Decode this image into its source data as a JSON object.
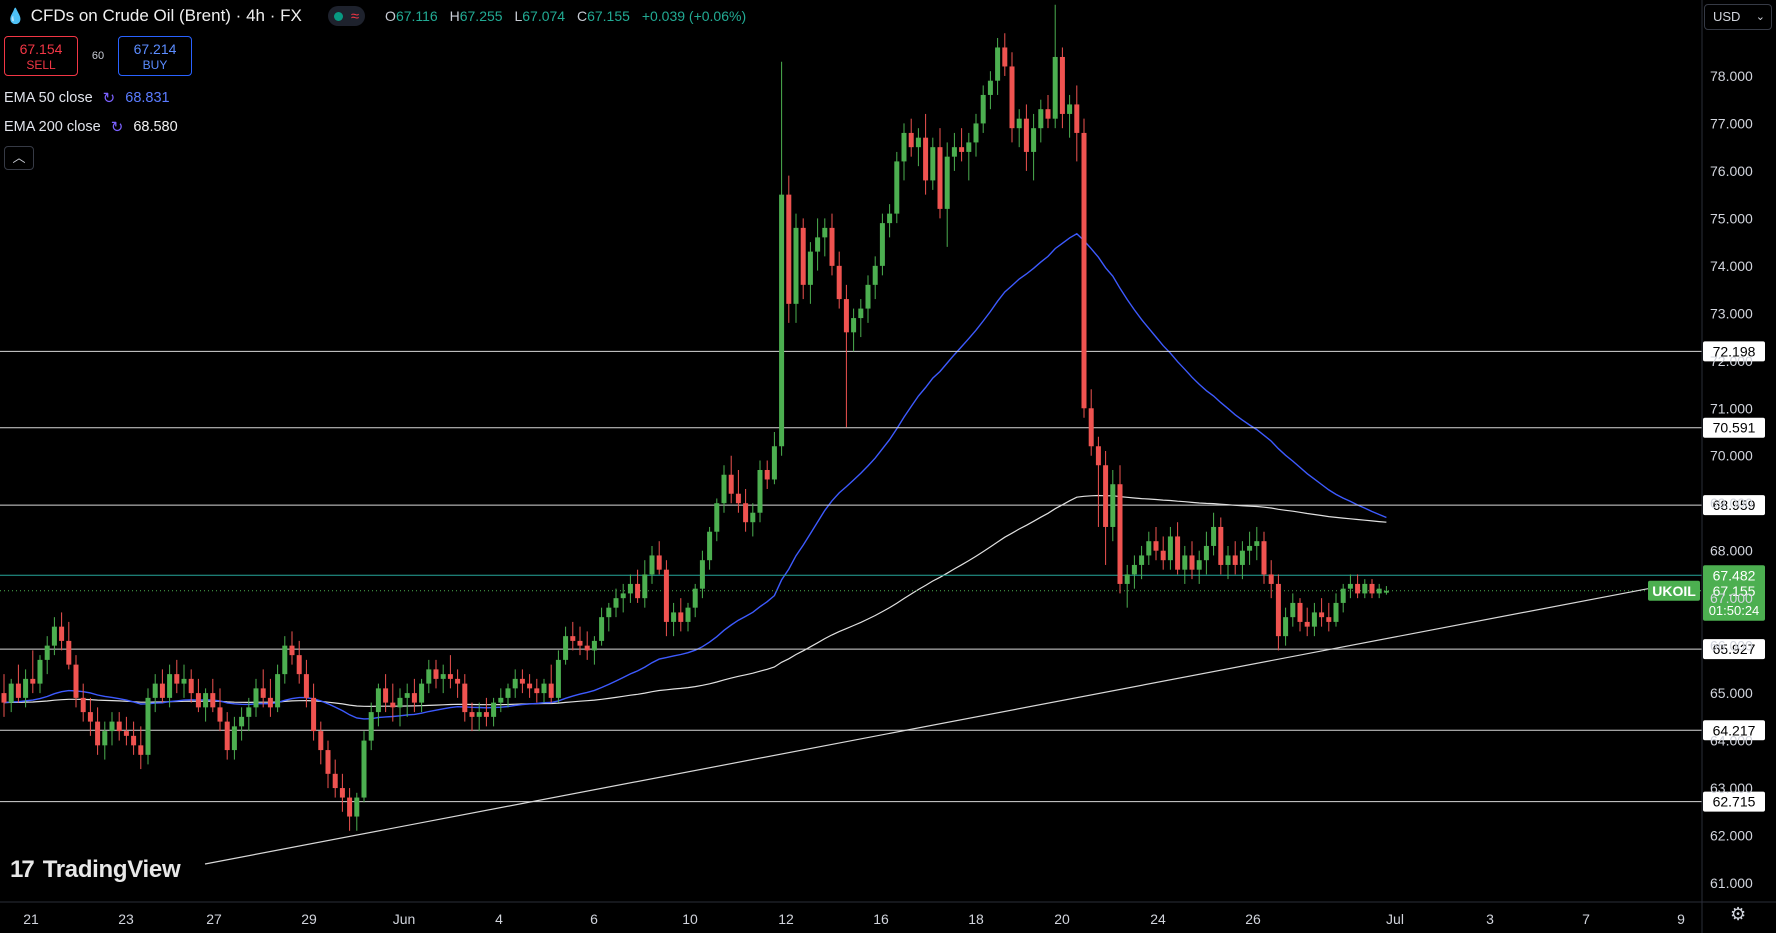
{
  "header": {
    "title": "CFDs on Crude Oil (Brent) · 4h · FX",
    "ohlc": [
      {
        "label": "O",
        "value": "67.116"
      },
      {
        "label": "H",
        "value": "67.255"
      },
      {
        "label": "L",
        "value": "67.074"
      },
      {
        "label": "C",
        "value": "67.155"
      }
    ],
    "change": "+0.039 (+0.06%)"
  },
  "trade": {
    "sell_price": "67.154",
    "sell_label": "SELL",
    "spread": "60",
    "buy_price": "67.214",
    "buy_label": "BUY"
  },
  "indicators": [
    {
      "label": "EMA 50 close",
      "value": "68.831",
      "color": "#3d5afe"
    },
    {
      "label": "EMA 200 close",
      "value": "68.580",
      "color": "#e0e0e0"
    }
  ],
  "currency": "USD",
  "logo_text": "TradingView",
  "colors": {
    "up": "#26a69a",
    "up_bright": "#4caf50",
    "down": "#ef5350",
    "bg": "#000000"
  },
  "chart_data": {
    "type": "candlestick",
    "symbol": "UKOIL",
    "ylim": [
      60.6,
      79.6
    ],
    "y_ticks": [
      "61.000",
      "62.000",
      "63.000",
      "64.000",
      "65.000",
      "66.000",
      "67.000",
      "68.000",
      "69.000",
      "70.000",
      "71.000",
      "72.000",
      "73.000",
      "74.000",
      "75.000",
      "76.000",
      "77.000",
      "78.000"
    ],
    "x_ticks": [
      "21",
      "23",
      "27",
      "29",
      "Jun",
      "4",
      "6",
      "10",
      "12",
      "16",
      "18",
      "20",
      "24",
      "26",
      "Jul",
      "3",
      "7",
      "9"
    ],
    "horizontal_levels": [
      "72.198",
      "70.591",
      "68.959",
      "67.482",
      "65.927",
      "64.217",
      "62.715"
    ],
    "last_price": "67.155",
    "countdown": "01:50:24",
    "candles": [
      [
        65.0,
        65.4,
        64.5,
        64.8
      ],
      [
        64.8,
        65.3,
        64.6,
        65.2
      ],
      [
        65.2,
        65.6,
        64.8,
        64.9
      ],
      [
        64.9,
        65.5,
        64.7,
        65.3
      ],
      [
        65.3,
        65.9,
        65.0,
        65.2
      ],
      [
        65.2,
        65.8,
        65.0,
        65.7
      ],
      [
        65.7,
        66.2,
        65.4,
        66.0
      ],
      [
        66.0,
        66.6,
        65.8,
        66.4
      ],
      [
        66.4,
        66.7,
        65.9,
        66.1
      ],
      [
        66.1,
        66.5,
        65.5,
        65.6
      ],
      [
        65.6,
        65.8,
        64.7,
        64.9
      ],
      [
        64.9,
        65.2,
        64.4,
        64.6
      ],
      [
        64.6,
        64.9,
        64.1,
        64.4
      ],
      [
        64.4,
        64.7,
        63.7,
        63.9
      ],
      [
        63.9,
        64.4,
        63.6,
        64.2
      ],
      [
        64.2,
        64.6,
        63.9,
        64.4
      ],
      [
        64.4,
        64.6,
        64.0,
        64.2
      ],
      [
        64.2,
        64.5,
        63.9,
        64.1
      ],
      [
        64.1,
        64.4,
        63.7,
        63.9
      ],
      [
        63.9,
        64.3,
        63.4,
        63.7
      ],
      [
        63.7,
        65.1,
        63.5,
        64.9
      ],
      [
        64.9,
        65.4,
        64.6,
        65.2
      ],
      [
        65.2,
        65.5,
        64.8,
        64.9
      ],
      [
        64.9,
        65.6,
        64.7,
        65.4
      ],
      [
        65.4,
        65.7,
        65.0,
        65.2
      ],
      [
        65.2,
        65.6,
        64.9,
        65.3
      ],
      [
        65.3,
        65.5,
        64.8,
        65.0
      ],
      [
        65.0,
        65.3,
        64.6,
        64.7
      ],
      [
        64.7,
        65.1,
        64.4,
        65.0
      ],
      [
        65.0,
        65.3,
        64.6,
        64.7
      ],
      [
        64.7,
        65.1,
        64.2,
        64.4
      ],
      [
        64.4,
        64.6,
        63.6,
        63.8
      ],
      [
        63.8,
        64.5,
        63.6,
        64.3
      ],
      [
        64.3,
        64.7,
        64.0,
        64.5
      ],
      [
        64.5,
        64.9,
        64.2,
        64.7
      ],
      [
        64.7,
        65.3,
        64.5,
        65.1
      ],
      [
        65.1,
        65.5,
        64.7,
        64.9
      ],
      [
        64.9,
        65.3,
        64.5,
        64.7
      ],
      [
        64.7,
        65.6,
        64.6,
        65.4
      ],
      [
        65.4,
        66.2,
        65.2,
        66.0
      ],
      [
        66.0,
        66.3,
        65.6,
        65.8
      ],
      [
        65.8,
        66.1,
        65.2,
        65.4
      ],
      [
        65.4,
        65.7,
        64.7,
        64.9
      ],
      [
        64.9,
        65.2,
        64.0,
        64.2
      ],
      [
        64.2,
        64.4,
        63.5,
        63.8
      ],
      [
        63.8,
        64.0,
        63.0,
        63.3
      ],
      [
        63.3,
        63.6,
        62.8,
        63.0
      ],
      [
        63.0,
        63.3,
        62.5,
        62.8
      ],
      [
        62.8,
        63.0,
        62.1,
        62.4
      ],
      [
        62.4,
        62.9,
        62.1,
        62.8
      ],
      [
        62.8,
        64.2,
        62.7,
        64.0
      ],
      [
        64.0,
        64.8,
        63.8,
        64.6
      ],
      [
        64.6,
        65.2,
        64.3,
        65.1
      ],
      [
        65.1,
        65.4,
        64.6,
        64.8
      ],
      [
        64.8,
        65.2,
        64.4,
        64.7
      ],
      [
        64.7,
        65.1,
        64.3,
        64.9
      ],
      [
        64.9,
        65.2,
        64.5,
        65.0
      ],
      [
        65.0,
        65.3,
        64.6,
        64.8
      ],
      [
        64.8,
        65.3,
        64.6,
        65.2
      ],
      [
        65.2,
        65.7,
        65.0,
        65.5
      ],
      [
        65.5,
        65.7,
        65.1,
        65.3
      ],
      [
        65.3,
        65.6,
        65.0,
        65.4
      ],
      [
        65.4,
        65.8,
        65.1,
        65.3
      ],
      [
        65.3,
        65.5,
        64.9,
        65.2
      ],
      [
        65.2,
        65.4,
        64.4,
        64.6
      ],
      [
        64.6,
        64.8,
        64.2,
        64.5
      ],
      [
        64.5,
        64.8,
        64.2,
        64.6
      ],
      [
        64.6,
        64.9,
        64.3,
        64.5
      ],
      [
        64.5,
        64.9,
        64.3,
        64.8
      ],
      [
        64.8,
        65.1,
        64.6,
        64.9
      ],
      [
        64.9,
        65.2,
        64.7,
        65.1
      ],
      [
        65.1,
        65.5,
        64.9,
        65.3
      ],
      [
        65.3,
        65.5,
        65.0,
        65.2
      ],
      [
        65.2,
        65.4,
        64.9,
        65.1
      ],
      [
        65.1,
        65.3,
        64.8,
        65.0
      ],
      [
        65.0,
        65.3,
        64.8,
        65.2
      ],
      [
        65.2,
        65.6,
        64.8,
        64.9
      ],
      [
        64.9,
        65.9,
        64.8,
        65.7
      ],
      [
        65.7,
        66.4,
        65.6,
        66.2
      ],
      [
        66.2,
        66.5,
        65.9,
        66.1
      ],
      [
        66.1,
        66.4,
        65.8,
        66.0
      ],
      [
        66.0,
        66.3,
        65.7,
        65.9
      ],
      [
        65.9,
        66.2,
        65.6,
        66.1
      ],
      [
        66.1,
        66.8,
        66.0,
        66.6
      ],
      [
        66.6,
        66.9,
        66.3,
        66.8
      ],
      [
        66.8,
        67.2,
        66.6,
        67.0
      ],
      [
        67.0,
        67.3,
        66.7,
        67.1
      ],
      [
        67.1,
        67.5,
        66.9,
        67.3
      ],
      [
        67.3,
        67.6,
        66.9,
        67.0
      ],
      [
        67.0,
        67.8,
        66.8,
        67.5
      ],
      [
        67.5,
        68.1,
        67.3,
        67.9
      ],
      [
        67.9,
        68.2,
        67.5,
        67.6
      ],
      [
        67.6,
        67.8,
        66.2,
        66.5
      ],
      [
        66.5,
        66.9,
        66.2,
        66.7
      ],
      [
        66.7,
        67.0,
        66.3,
        66.5
      ],
      [
        66.5,
        66.9,
        66.3,
        66.8
      ],
      [
        66.8,
        67.3,
        66.6,
        67.2
      ],
      [
        67.2,
        68.0,
        67.0,
        67.8
      ],
      [
        67.8,
        68.5,
        67.6,
        68.4
      ],
      [
        68.4,
        69.1,
        68.2,
        69.0
      ],
      [
        69.0,
        69.8,
        68.8,
        69.6
      ],
      [
        69.6,
        70.0,
        69.0,
        69.2
      ],
      [
        69.2,
        69.7,
        68.8,
        69.0
      ],
      [
        69.0,
        69.3,
        68.4,
        68.6
      ],
      [
        68.6,
        69.0,
        68.3,
        68.8
      ],
      [
        68.8,
        69.9,
        68.6,
        69.7
      ],
      [
        69.7,
        69.9,
        69.3,
        69.5
      ],
      [
        69.5,
        70.5,
        69.4,
        70.2
      ],
      [
        70.2,
        78.3,
        70.0,
        75.5
      ],
      [
        75.5,
        75.9,
        72.8,
        73.2
      ],
      [
        73.2,
        75.1,
        72.8,
        74.8
      ],
      [
        74.8,
        75.0,
        73.3,
        73.6
      ],
      [
        73.6,
        74.5,
        73.2,
        74.3
      ],
      [
        74.3,
        75.0,
        73.9,
        74.6
      ],
      [
        74.6,
        75.0,
        74.2,
        74.8
      ],
      [
        74.8,
        75.1,
        73.8,
        74.0
      ],
      [
        74.0,
        74.3,
        73.1,
        73.3
      ],
      [
        73.3,
        73.6,
        70.6,
        72.6
      ],
      [
        72.6,
        73.1,
        72.2,
        72.9
      ],
      [
        72.9,
        73.3,
        72.5,
        73.1
      ],
      [
        73.1,
        73.8,
        72.8,
        73.6
      ],
      [
        73.6,
        74.2,
        73.3,
        74.0
      ],
      [
        74.0,
        75.1,
        73.8,
        74.9
      ],
      [
        74.9,
        75.3,
        74.6,
        75.1
      ],
      [
        75.1,
        76.4,
        74.9,
        76.2
      ],
      [
        76.2,
        77.0,
        75.8,
        76.8
      ],
      [
        76.8,
        77.1,
        76.3,
        76.5
      ],
      [
        76.5,
        76.9,
        76.1,
        76.7
      ],
      [
        76.7,
        77.2,
        75.5,
        75.8
      ],
      [
        75.8,
        76.7,
        75.6,
        76.5
      ],
      [
        76.5,
        76.9,
        75.0,
        75.2
      ],
      [
        75.2,
        76.6,
        74.4,
        76.3
      ],
      [
        76.3,
        76.8,
        76.0,
        76.5
      ],
      [
        76.5,
        76.9,
        76.2,
        76.4
      ],
      [
        76.4,
        76.8,
        75.8,
        76.6
      ],
      [
        76.6,
        77.2,
        76.3,
        77.0
      ],
      [
        77.0,
        77.8,
        76.8,
        77.6
      ],
      [
        77.6,
        78.1,
        77.3,
        77.9
      ],
      [
        77.9,
        78.8,
        77.6,
        78.6
      ],
      [
        78.6,
        78.9,
        78.0,
        78.2
      ],
      [
        78.2,
        78.5,
        76.6,
        76.9
      ],
      [
        76.9,
        77.3,
        76.5,
        77.1
      ],
      [
        77.1,
        77.4,
        76.0,
        76.4
      ],
      [
        76.4,
        77.2,
        75.8,
        76.9
      ],
      [
        76.9,
        77.5,
        76.6,
        77.3
      ],
      [
        77.3,
        77.6,
        76.9,
        77.1
      ],
      [
        77.1,
        79.5,
        76.9,
        78.4
      ],
      [
        78.4,
        78.6,
        76.9,
        77.2
      ],
      [
        77.2,
        77.6,
        76.7,
        77.4
      ],
      [
        77.4,
        77.8,
        76.2,
        76.8
      ],
      [
        76.8,
        77.1,
        70.8,
        71.0
      ],
      [
        71.0,
        71.4,
        70.0,
        70.2
      ],
      [
        70.2,
        70.4,
        68.5,
        69.8
      ],
      [
        69.8,
        70.1,
        67.7,
        68.5
      ],
      [
        68.5,
        69.7,
        68.2,
        69.4
      ],
      [
        69.4,
        69.8,
        67.1,
        67.3
      ],
      [
        67.3,
        67.7,
        66.8,
        67.5
      ],
      [
        67.5,
        67.9,
        67.2,
        67.7
      ],
      [
        67.7,
        68.1,
        67.4,
        67.9
      ],
      [
        67.9,
        68.4,
        67.7,
        68.2
      ],
      [
        68.2,
        68.5,
        67.8,
        68.0
      ],
      [
        68.0,
        68.3,
        67.6,
        67.8
      ],
      [
        67.8,
        68.5,
        67.6,
        68.3
      ],
      [
        68.3,
        68.6,
        67.5,
        67.6
      ],
      [
        67.6,
        68.1,
        67.3,
        67.9
      ],
      [
        67.9,
        68.2,
        67.4,
        67.6
      ],
      [
        67.6,
        68.0,
        67.3,
        67.8
      ],
      [
        67.8,
        68.4,
        67.5,
        68.1
      ],
      [
        68.1,
        68.8,
        67.9,
        68.5
      ],
      [
        68.5,
        68.7,
        67.5,
        67.7
      ],
      [
        67.7,
        68.1,
        67.4,
        67.9
      ],
      [
        67.9,
        68.2,
        67.5,
        67.7
      ],
      [
        67.7,
        68.2,
        67.4,
        68.0
      ],
      [
        68.0,
        68.4,
        67.7,
        68.1
      ],
      [
        68.1,
        68.5,
        67.8,
        68.2
      ],
      [
        68.2,
        68.4,
        67.3,
        67.5
      ],
      [
        67.5,
        67.8,
        67.0,
        67.3
      ],
      [
        67.3,
        67.5,
        65.9,
        66.2
      ],
      [
        66.2,
        66.8,
        66.0,
        66.6
      ],
      [
        66.6,
        67.1,
        66.4,
        66.9
      ],
      [
        66.9,
        67.0,
        66.3,
        66.5
      ],
      [
        66.5,
        66.8,
        66.2,
        66.4
      ],
      [
        66.4,
        66.9,
        66.2,
        66.7
      ],
      [
        66.7,
        67.0,
        66.4,
        66.6
      ],
      [
        66.6,
        66.9,
        66.3,
        66.5
      ],
      [
        66.5,
        67.1,
        66.4,
        66.9
      ],
      [
        66.9,
        67.3,
        66.7,
        67.2
      ],
      [
        67.2,
        67.5,
        67.0,
        67.3
      ],
      [
        67.3,
        67.5,
        67.0,
        67.1
      ],
      [
        67.1,
        67.4,
        67.0,
        67.3
      ],
      [
        67.3,
        67.4,
        67.0,
        67.1
      ],
      [
        67.1,
        67.3,
        67.0,
        67.2
      ],
      [
        67.116,
        67.255,
        67.074,
        67.155
      ]
    ]
  }
}
